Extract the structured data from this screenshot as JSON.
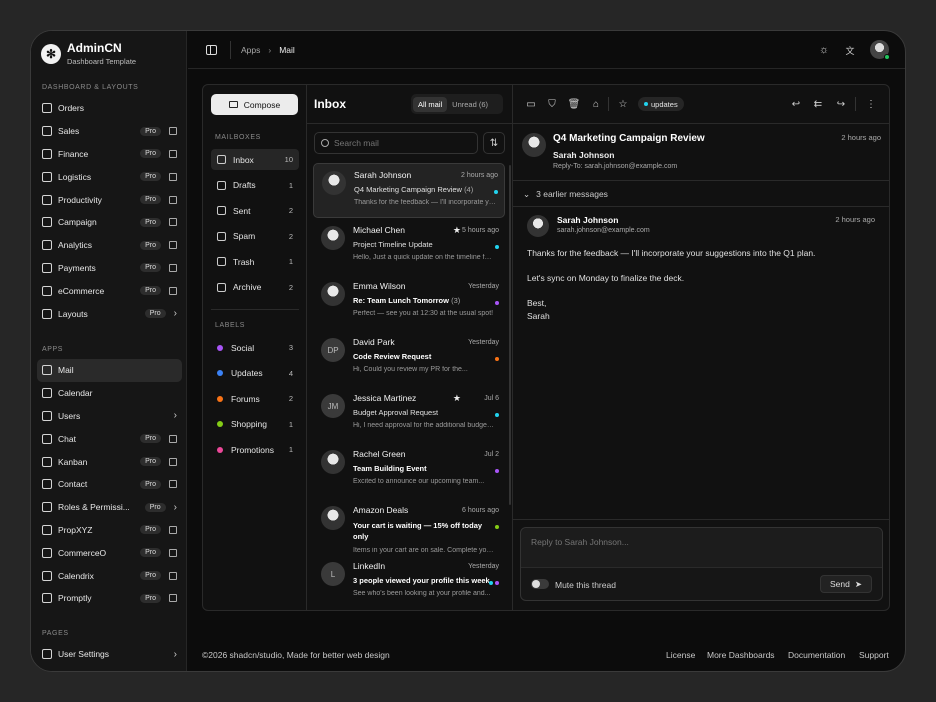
{
  "brand": {
    "title": "AdminCN",
    "subtitle": "Dashboard Template",
    "logo": "✻"
  },
  "sections": {
    "dashboard": "DASHBOARD & LAYOUTS",
    "apps": "APPS",
    "pages": "PAGES"
  },
  "nav_dashboard": [
    {
      "label": "Orders",
      "pro": "",
      "action": ""
    },
    {
      "label": "Sales",
      "pro": "Pro",
      "action": "ext"
    },
    {
      "label": "Finance",
      "pro": "Pro",
      "action": "ext"
    },
    {
      "label": "Logistics",
      "pro": "Pro",
      "action": "ext"
    },
    {
      "label": "Productivity",
      "pro": "Pro",
      "action": "ext"
    },
    {
      "label": "Campaign",
      "pro": "Pro",
      "action": "ext"
    },
    {
      "label": "Analytics",
      "pro": "Pro",
      "action": "ext"
    },
    {
      "label": "Payments",
      "pro": "Pro",
      "action": "ext"
    },
    {
      "label": "eCommerce",
      "pro": "Pro",
      "action": "ext"
    },
    {
      "label": "Layouts",
      "pro": "Pro",
      "action": "chev"
    }
  ],
  "nav_apps": [
    {
      "label": "Mail",
      "pro": "",
      "action": "",
      "active": true
    },
    {
      "label": "Calendar",
      "pro": "",
      "action": ""
    },
    {
      "label": "Users",
      "pro": "",
      "action": "chev"
    },
    {
      "label": "Chat",
      "pro": "Pro",
      "action": "ext"
    },
    {
      "label": "Kanban",
      "pro": "Pro",
      "action": "ext"
    },
    {
      "label": "Contact",
      "pro": "Pro",
      "action": "ext"
    },
    {
      "label": "Roles & Permissi...",
      "pro": "Pro",
      "action": "chev"
    },
    {
      "label": "PropXYZ",
      "pro": "Pro",
      "action": "ext"
    },
    {
      "label": "CommerceO",
      "pro": "Pro",
      "action": "ext"
    },
    {
      "label": "Calendrix",
      "pro": "Pro",
      "action": "ext"
    },
    {
      "label": "Promptly",
      "pro": "Pro",
      "action": "ext"
    }
  ],
  "nav_pages": [
    {
      "label": "User Settings",
      "action": "chev"
    }
  ],
  "breadcrumb": {
    "parent": "Apps",
    "current": "Mail"
  },
  "mail": {
    "compose": "Compose",
    "mailboxes_label": "MAILBOXES",
    "mailboxes": [
      {
        "label": "Inbox",
        "count": "10",
        "active": true
      },
      {
        "label": "Drafts",
        "count": "1"
      },
      {
        "label": "Sent",
        "count": "2"
      },
      {
        "label": "Spam",
        "count": "2"
      },
      {
        "label": "Trash",
        "count": "1"
      },
      {
        "label": "Archive",
        "count": "2"
      }
    ],
    "labels_label": "LABELS",
    "labels": [
      {
        "label": "Social",
        "count": "3",
        "color": "#a855f7"
      },
      {
        "label": "Updates",
        "count": "4",
        "color": "#3b82f6"
      },
      {
        "label": "Forums",
        "count": "2",
        "color": "#f97316"
      },
      {
        "label": "Shopping",
        "count": "1",
        "color": "#84cc16"
      },
      {
        "label": "Promotions",
        "count": "1",
        "color": "#ec4899"
      }
    ],
    "list_title": "Inbox",
    "filter_all": "All mail",
    "filter_unread": "Unread (6)",
    "search_placeholder": "Search mail",
    "messages": [
      {
        "from": "Sarah Johnson",
        "time": "2 hours ago",
        "subject": "Q4 Marketing Campaign Review",
        "count": "(4)",
        "preview": "Thanks for the feedback — I'll incorporate you...",
        "initials": "",
        "photo": true,
        "bold": false,
        "star": false,
        "active": true,
        "tags": [
          "#22d3ee"
        ]
      },
      {
        "from": "Michael Chen",
        "time": "5 hours ago",
        "subject": "Project Timeline Update",
        "count": "",
        "preview": "Hello, Just a quick update on the timeline for...",
        "initials": "",
        "photo": true,
        "bold": false,
        "star": true,
        "tags": [
          "#22d3ee"
        ]
      },
      {
        "from": "Emma Wilson",
        "time": "Yesterday",
        "subject": "Re: Team Lunch Tomorrow",
        "count": "(3)",
        "preview": "Perfect — see you at 12:30 at the usual spot!",
        "initials": "",
        "photo": true,
        "bold": true,
        "star": false,
        "tags": [
          "#a855f7"
        ]
      },
      {
        "from": "David Park",
        "time": "Yesterday",
        "subject": "Code Review Request",
        "count": "",
        "preview": "Hi, Could you review my PR for the...",
        "initials": "DP",
        "photo": false,
        "bold": true,
        "star": false,
        "tags": [
          "#f97316"
        ]
      },
      {
        "from": "Jessica Martinez",
        "time": "Jul 6",
        "subject": "Budget Approval Request",
        "count": "",
        "preview": "Hi, I need approval for the additional budget fo...",
        "initials": "JM",
        "photo": false,
        "bold": false,
        "star": true,
        "tags": [
          "#22d3ee"
        ]
      },
      {
        "from": "Rachel Green",
        "time": "Jul 2",
        "subject": "Team Building Event",
        "count": "",
        "preview": "Excited to announce our upcoming team...",
        "initials": "",
        "photo": true,
        "bold": true,
        "star": false,
        "tags": [
          "#a855f7"
        ]
      },
      {
        "from": "Amazon Deals",
        "time": "6 hours ago",
        "subject": "Your cart is waiting — 15% off today only",
        "count": "",
        "preview": "Items in your cart are on sale. Complete your...",
        "initials": "",
        "photo": true,
        "bold": true,
        "star": false,
        "tags": [
          "#84cc16"
        ]
      },
      {
        "from": "LinkedIn",
        "time": "Yesterday",
        "subject": "3 people viewed your profile this week",
        "count": "",
        "preview": "See who's been looking at your profile and...",
        "initials": "L",
        "photo": false,
        "bold": true,
        "star": false,
        "tags": [
          "#a855f7",
          "#22d3ee"
        ]
      }
    ],
    "toolbar_tag": "updates",
    "detail": {
      "subject": "Q4 Marketing Campaign Review",
      "time": "2 hours ago",
      "from": "Sarah Johnson",
      "reply_to": "Reply-To: sarah.johnson@example.com",
      "earlier": "3 earlier messages",
      "msg_from": "Sarah Johnson",
      "msg_email": "sarah.johnson@example.com",
      "msg_time": "2 hours ago",
      "body1": "Thanks for the feedback — I'll incorporate your suggestions into the Q1 plan.",
      "body2": "Let's sync on Monday to finalize the deck.",
      "body3": "Best,",
      "body4": "Sarah",
      "reply_placeholder": "Reply to Sarah Johnson...",
      "mute": "Mute this thread",
      "send": "Send"
    }
  },
  "footer": {
    "copyright": "©2026 shadcn/studio, Made for better web design",
    "links": [
      "License",
      "More Dashboards",
      "Documentation",
      "Support"
    ]
  }
}
